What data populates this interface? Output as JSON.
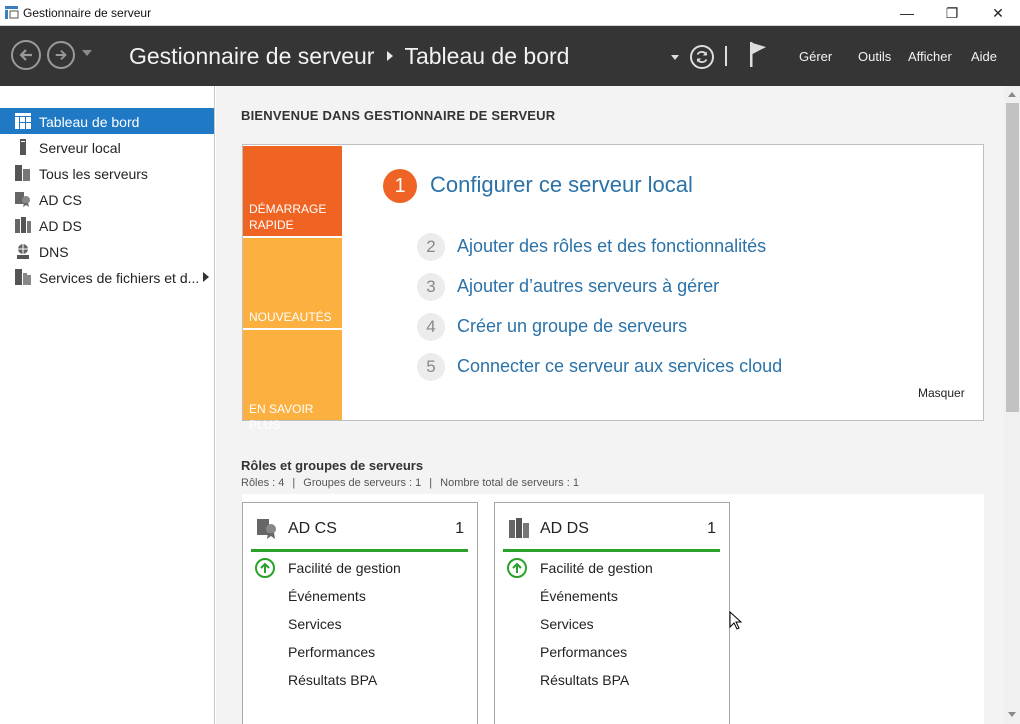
{
  "window": {
    "title": "Gestionnaire de serveur",
    "minimize": "—",
    "maximize": "❐",
    "close": "✕"
  },
  "toolbar": {
    "breadcrumb_root": "Gestionnaire de serveur",
    "breadcrumb_current": "Tableau de bord",
    "menu": {
      "manage": "Gérer",
      "tools": "Outils",
      "view": "Afficher",
      "help": "Aide"
    }
  },
  "sidebar": {
    "items": [
      {
        "label": "Tableau de bord",
        "icon": "dashboard-icon",
        "active": true
      },
      {
        "label": "Serveur local",
        "icon": "local-server-icon"
      },
      {
        "label": "Tous les serveurs",
        "icon": "all-servers-icon"
      },
      {
        "label": "AD CS",
        "icon": "adcs-icon"
      },
      {
        "label": "AD DS",
        "icon": "adds-icon"
      },
      {
        "label": "DNS",
        "icon": "dns-icon"
      },
      {
        "label": "Services de fichiers et d...",
        "icon": "file-services-icon"
      }
    ]
  },
  "welcome": {
    "heading": "BIENVENUE DANS GESTIONNAIRE DE SERVEUR",
    "tiles": [
      {
        "label": "DÉMARRAGE RAPIDE",
        "color": "#f06423"
      },
      {
        "label": "NOUVEAUTÉS",
        "color": "#fbb040"
      },
      {
        "label": "EN SAVOIR PLUS",
        "color": "#fbb040"
      }
    ],
    "main_step": {
      "number": "1",
      "label": "Configurer ce serveur local"
    },
    "steps": [
      {
        "number": "2",
        "label": "Ajouter des rôles et des fonctionnalités"
      },
      {
        "number": "3",
        "label": "Ajouter d’autres serveurs à gérer"
      },
      {
        "number": "4",
        "label": "Créer un groupe de serveurs"
      },
      {
        "number": "5",
        "label": "Connecter ce serveur aux services cloud"
      }
    ],
    "hide": "Masquer"
  },
  "roles": {
    "heading": "Rôles et groupes de serveurs",
    "roles_count": "Rôles : 4",
    "groups_count": "Groupes de serveurs : 1",
    "servers_count": "Nombre total de serveurs : 1",
    "separator": "|",
    "cards": [
      {
        "name": "AD CS",
        "count": "1",
        "rows": [
          "Facilité de gestion",
          "Événements",
          "Services",
          "Performances",
          "Résultats BPA"
        ]
      },
      {
        "name": "AD DS",
        "count": "1",
        "rows": [
          "Facilité de gestion",
          "Événements",
          "Services",
          "Performances",
          "Résultats BPA"
        ]
      }
    ]
  },
  "colors": {
    "accent": "#1f79c5",
    "link": "#2a72a8",
    "status_ok": "#2aa12a",
    "toolbar_bg": "#353535"
  }
}
